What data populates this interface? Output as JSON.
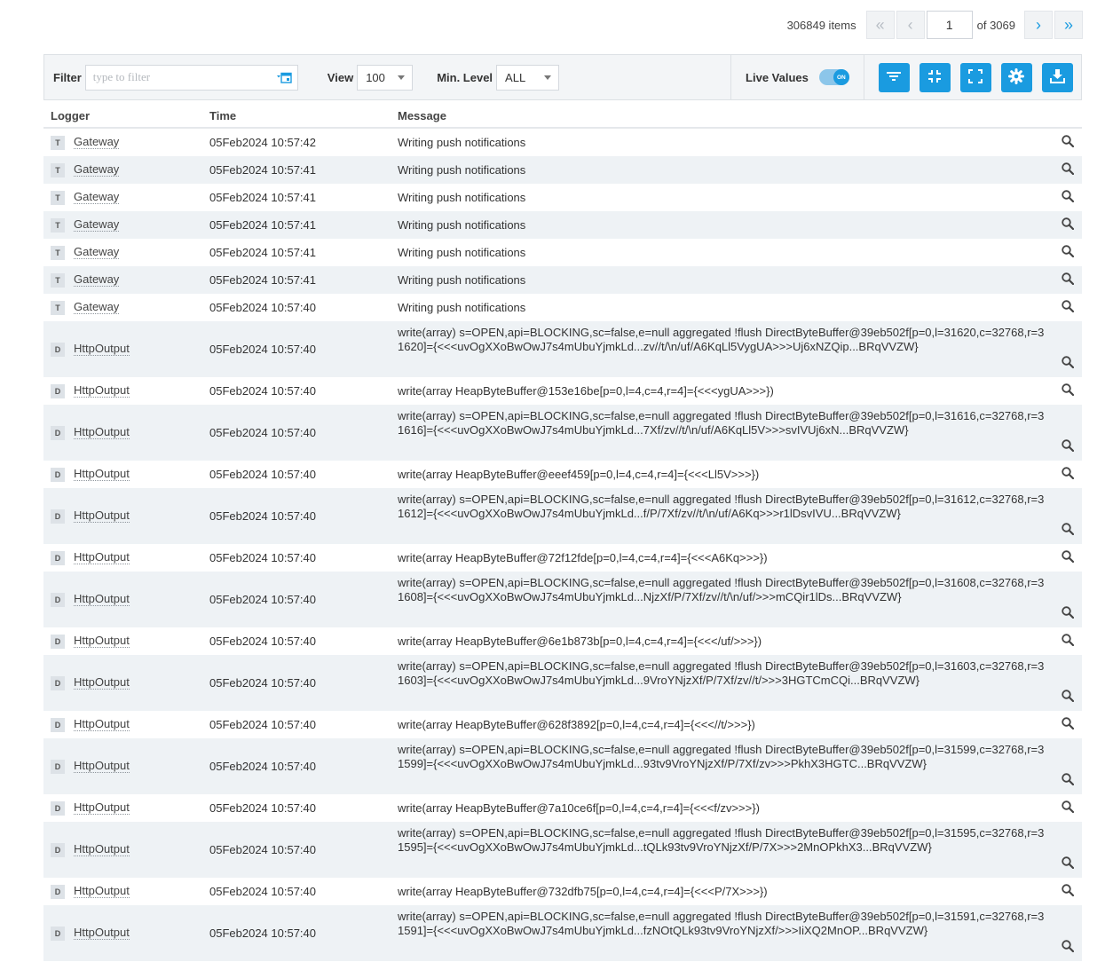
{
  "pager": {
    "items_label": "306849 items",
    "first_symbol": "«",
    "prev_symbol": "‹",
    "page": "1",
    "of_label": "of 3069",
    "next_symbol": "›",
    "last_symbol": "»"
  },
  "toolbar": {
    "filter_label": "Filter",
    "filter_placeholder": "type to filter",
    "view_label": "View",
    "view_value": "100",
    "level_label": "Min. Level",
    "level_value": "ALL",
    "live_label": "Live Values",
    "live_state": "ON"
  },
  "table": {
    "headers": {
      "logger": "Logger",
      "time": "Time",
      "message": "Message"
    },
    "rows": [
      {
        "level": "T",
        "logger": "Gateway",
        "time": "05Feb2024 10:57:42",
        "message": "Writing push notifications"
      },
      {
        "level": "T",
        "logger": "Gateway",
        "time": "05Feb2024 10:57:41",
        "message": "Writing push notifications"
      },
      {
        "level": "T",
        "logger": "Gateway",
        "time": "05Feb2024 10:57:41",
        "message": "Writing push notifications"
      },
      {
        "level": "T",
        "logger": "Gateway",
        "time": "05Feb2024 10:57:41",
        "message": "Writing push notifications"
      },
      {
        "level": "T",
        "logger": "Gateway",
        "time": "05Feb2024 10:57:41",
        "message": "Writing push notifications"
      },
      {
        "level": "T",
        "logger": "Gateway",
        "time": "05Feb2024 10:57:41",
        "message": "Writing push notifications"
      },
      {
        "level": "T",
        "logger": "Gateway",
        "time": "05Feb2024 10:57:40",
        "message": "Writing push notifications"
      },
      {
        "level": "D",
        "logger": "HttpOutput",
        "time": "05Feb2024 10:57:40",
        "message": "write(array) s=OPEN,api=BLOCKING,sc=false,e=null aggregated !flush DirectByteBuffer@39eb502f[p=0,l=31620,c=32768,r=31620]={<<<uvOgXXoBwOwJ7s4mUbuYjmkLd...zv//t/\\n/uf/A6KqLl5VygUA>>>Uj6xNZQip...BRqVVZW}"
      },
      {
        "level": "D",
        "logger": "HttpOutput",
        "time": "05Feb2024 10:57:40",
        "message": "write(array HeapByteBuffer@153e16be[p=0,l=4,c=4,r=4]={<<<ygUA>>>})"
      },
      {
        "level": "D",
        "logger": "HttpOutput",
        "time": "05Feb2024 10:57:40",
        "message": "write(array) s=OPEN,api=BLOCKING,sc=false,e=null aggregated !flush DirectByteBuffer@39eb502f[p=0,l=31616,c=32768,r=31616]={<<<uvOgXXoBwOwJ7s4mUbuYjmkLd...7Xf/zv//t/\\n/uf/A6KqLl5V>>>svIVUj6xN...BRqVVZW}"
      },
      {
        "level": "D",
        "logger": "HttpOutput",
        "time": "05Feb2024 10:57:40",
        "message": "write(array HeapByteBuffer@eeef459[p=0,l=4,c=4,r=4]={<<<Ll5V>>>})"
      },
      {
        "level": "D",
        "logger": "HttpOutput",
        "time": "05Feb2024 10:57:40",
        "message": "write(array) s=OPEN,api=BLOCKING,sc=false,e=null aggregated !flush DirectByteBuffer@39eb502f[p=0,l=31612,c=32768,r=31612]={<<<uvOgXXoBwOwJ7s4mUbuYjmkLd...f/P/7Xf/zv//t/\\n/uf/A6Kq>>>r1lDsvIVU...BRqVVZW}"
      },
      {
        "level": "D",
        "logger": "HttpOutput",
        "time": "05Feb2024 10:57:40",
        "message": "write(array HeapByteBuffer@72f12fde[p=0,l=4,c=4,r=4]={<<<A6Kq>>>})"
      },
      {
        "level": "D",
        "logger": "HttpOutput",
        "time": "05Feb2024 10:57:40",
        "message": "write(array) s=OPEN,api=BLOCKING,sc=false,e=null aggregated !flush DirectByteBuffer@39eb502f[p=0,l=31608,c=32768,r=31608]={<<<uvOgXXoBwOwJ7s4mUbuYjmkLd...NjzXf/P/7Xf/zv//t/\\n/uf/>>>mCQir1lDs...BRqVVZW}"
      },
      {
        "level": "D",
        "logger": "HttpOutput",
        "time": "05Feb2024 10:57:40",
        "message": "write(array HeapByteBuffer@6e1b873b[p=0,l=4,c=4,r=4]={<<</uf/>>>})"
      },
      {
        "level": "D",
        "logger": "HttpOutput",
        "time": "05Feb2024 10:57:40",
        "message": "write(array) s=OPEN,api=BLOCKING,sc=false,e=null aggregated !flush DirectByteBuffer@39eb502f[p=0,l=31603,c=32768,r=31603]={<<<uvOgXXoBwOwJ7s4mUbuYjmkLd...9VroYNjzXf/P/7Xf/zv//t/>>>3HGTCmCQi...BRqVVZW}"
      },
      {
        "level": "D",
        "logger": "HttpOutput",
        "time": "05Feb2024 10:57:40",
        "message": "write(array HeapByteBuffer@628f3892[p=0,l=4,c=4,r=4]={<<<//t/>>>})"
      },
      {
        "level": "D",
        "logger": "HttpOutput",
        "time": "05Feb2024 10:57:40",
        "message": "write(array) s=OPEN,api=BLOCKING,sc=false,e=null aggregated !flush DirectByteBuffer@39eb502f[p=0,l=31599,c=32768,r=31599]={<<<uvOgXXoBwOwJ7s4mUbuYjmkLd...93tv9VroYNjzXf/P/7Xf/zv>>>PkhX3HGTC...BRqVVZW}"
      },
      {
        "level": "D",
        "logger": "HttpOutput",
        "time": "05Feb2024 10:57:40",
        "message": "write(array HeapByteBuffer@7a10ce6f[p=0,l=4,c=4,r=4]={<<<f/zv>>>})"
      },
      {
        "level": "D",
        "logger": "HttpOutput",
        "time": "05Feb2024 10:57:40",
        "message": "write(array) s=OPEN,api=BLOCKING,sc=false,e=null aggregated !flush DirectByteBuffer@39eb502f[p=0,l=31595,c=32768,r=31595]={<<<uvOgXXoBwOwJ7s4mUbuYjmkLd...tQLk93tv9VroYNjzXf/P/7X>>>2MnOPkhX3...BRqVVZW}"
      },
      {
        "level": "D",
        "logger": "HttpOutput",
        "time": "05Feb2024 10:57:40",
        "message": "write(array HeapByteBuffer@732dfb75[p=0,l=4,c=4,r=4]={<<<P/7X>>>})"
      },
      {
        "level": "D",
        "logger": "HttpOutput",
        "time": "05Feb2024 10:57:40",
        "message": "write(array) s=OPEN,api=BLOCKING,sc=false,e=null aggregated !flush DirectByteBuffer@39eb502f[p=0,l=31591,c=32768,r=31591]={<<<uvOgXXoBwOwJ7s4mUbuYjmkLd...fzNOtQLk93tv9VroYNjzXf/>>>IiXQ2MnOP...BRqVVZW}"
      }
    ]
  },
  "icons": {
    "row_action": "search-icon",
    "filter_box": "calendar-filter-icon",
    "toolbar": [
      "filter-icon",
      "collapse-icon",
      "fullscreen-icon",
      "settings-icon",
      "download-icon"
    ]
  },
  "colors": {
    "accent": "#1a9be0",
    "row_stripe": "#eef2f5",
    "toolbar_bg": "#f3f5f7"
  }
}
